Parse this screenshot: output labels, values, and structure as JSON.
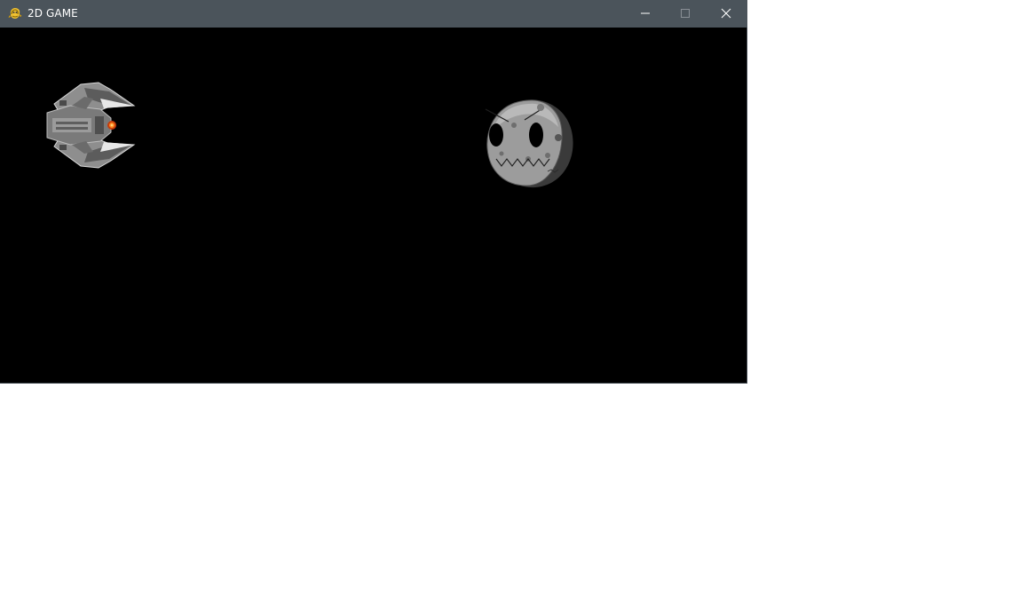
{
  "window": {
    "title": "2D GAME",
    "controls": {
      "minimize": "minimize-icon",
      "maximize": "maximize-icon",
      "close": "close-icon"
    },
    "colors": {
      "titlebar": "#4b545b",
      "canvas": "#000000"
    }
  },
  "game": {
    "player": {
      "icon": "spaceship-sprite"
    },
    "enemy": {
      "icon": "skull-asteroid-sprite"
    }
  }
}
